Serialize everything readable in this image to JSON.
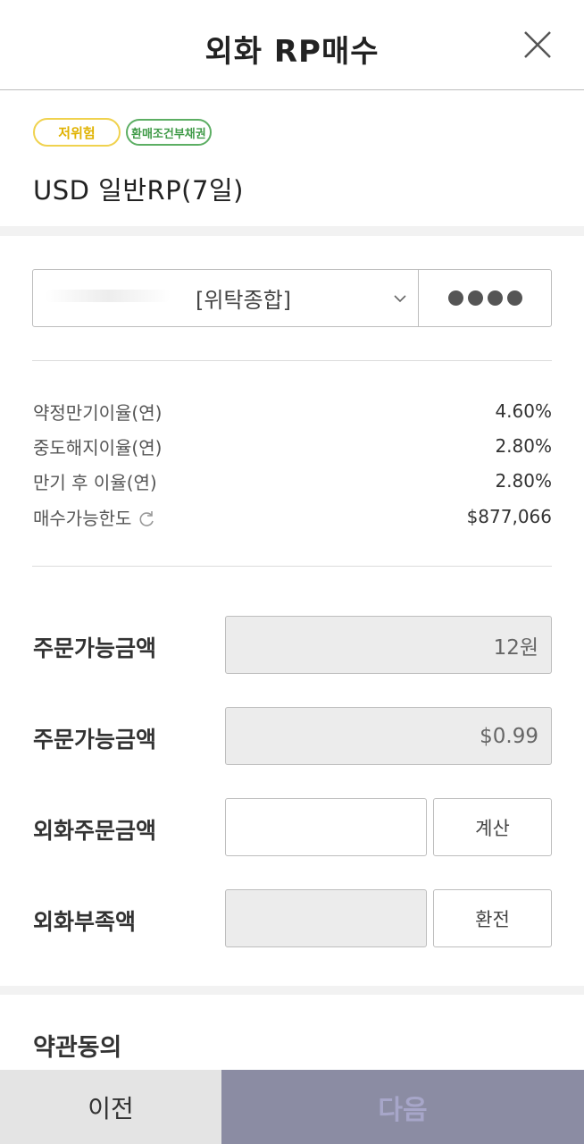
{
  "header": {
    "title": "외화 RP매수",
    "close_icon": "close-icon"
  },
  "product": {
    "risk_badge": "저위험",
    "type_badge": "환매조건부채권",
    "name": "USD 일반RP(7일)",
    "colors": {
      "risk": "#f0d24e",
      "type": "#5cae63"
    }
  },
  "account": {
    "label": "[위탁종합]",
    "password_mask": "●●●●",
    "dropdown_icon": "chevron-down-icon"
  },
  "rates": [
    {
      "label": "약정만기이율(연)",
      "value": "4.60%"
    },
    {
      "label": "중도해지이율(연)",
      "value": "2.80%"
    },
    {
      "label": "만기 후 이율(연)",
      "value": "2.80%"
    },
    {
      "label": "매수가능한도",
      "value": "$877,066",
      "icon": "refresh-icon"
    }
  ],
  "order": {
    "krw_available": {
      "label": "주문가능금액",
      "value": "12원"
    },
    "usd_available": {
      "label": "주문가능금액",
      "value": "$0.99"
    },
    "fx_order_amount": {
      "label": "외화주문금액",
      "value": "",
      "button": "계산"
    },
    "fx_shortfall": {
      "label": "외화부족액",
      "value": "",
      "button": "환전"
    }
  },
  "terms": {
    "title": "약관동의"
  },
  "footer": {
    "prev_label": "이전",
    "next_label": "다음",
    "colors": {
      "next_bg": "#8b8ca3",
      "prev_bg": "#e4e4e4"
    }
  }
}
